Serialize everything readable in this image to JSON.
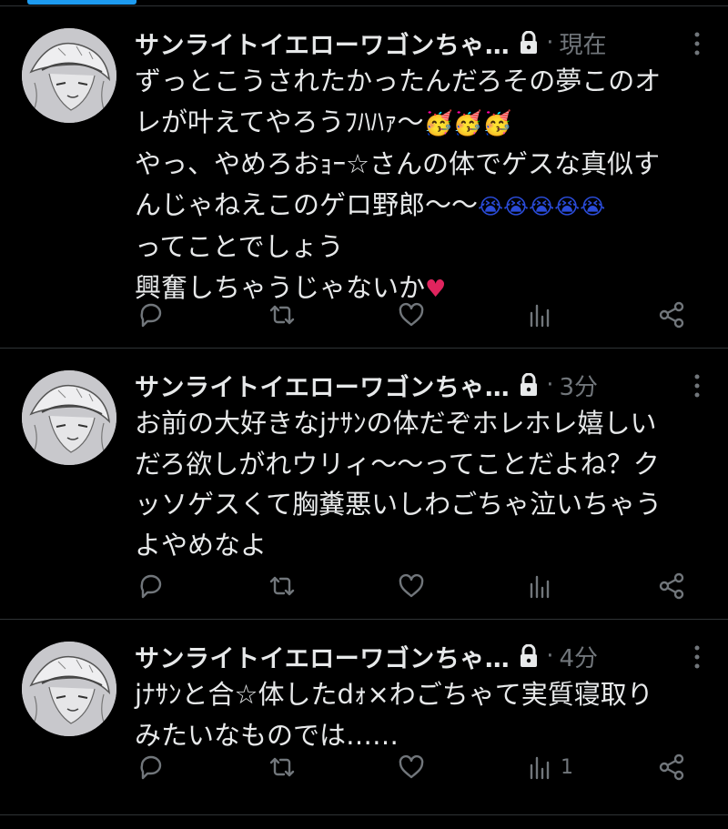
{
  "tweets": [
    {
      "display_name": "サンライトイエローワゴンちゃ…",
      "time": "現在",
      "lines": [
        {
          "text": "ずっとこうされたかったんだろその夢このオ",
          "emoji": ""
        },
        {
          "text": "レが叶えてやろうﾌﾊﾊｧ〜",
          "emoji": "🥳🥳🥳"
        },
        {
          "text": "やっ、やめろおｮｰ☆さんの体でゲスな真似す",
          "emoji": ""
        },
        {
          "text": "んじゃねえこのゲロ野郎〜〜",
          "emoji": "😭😭😭😭😭"
        },
        {
          "text": "ってことでしょう",
          "emoji": ""
        },
        {
          "text": "興奮しちゃうじゃないか",
          "emoji": "♥"
        }
      ],
      "views_count": ""
    },
    {
      "display_name": "サンライトイエローワゴンちゃ…",
      "time": "3分",
      "lines": [
        {
          "text": "お前の大好きなjﾅｻﾝの体だぞホレホレ嬉しい",
          "emoji": ""
        },
        {
          "text": "だろ欲しがれウリィ〜〜ってことだよね？ク",
          "emoji": ""
        },
        {
          "text": "ッソゲスくて胸糞悪いしわごちゃ泣いちゃう",
          "emoji": ""
        },
        {
          "text": "よやめなよ",
          "emoji": ""
        }
      ],
      "views_count": ""
    },
    {
      "display_name": "サンライトイエローワゴンちゃ…",
      "time": "4分",
      "lines": [
        {
          "text": "jﾅｻﾝと合☆体したdｫ×わごちゃて実質寝取り",
          "emoji": ""
        },
        {
          "text": "みたいなものでは……",
          "emoji": ""
        }
      ],
      "views_count": "1"
    }
  ],
  "icons": {
    "reply": "reply-icon",
    "retweet": "retweet-icon",
    "like": "heart-icon",
    "views": "views-icon",
    "share": "share-icon",
    "more": "more-icon",
    "lock": "lock-icon"
  },
  "colors": {
    "background": "#000000",
    "text": "#e7e9ea",
    "muted": "#71767b",
    "accent": "#1d9bf0",
    "divider": "#2f3336"
  }
}
